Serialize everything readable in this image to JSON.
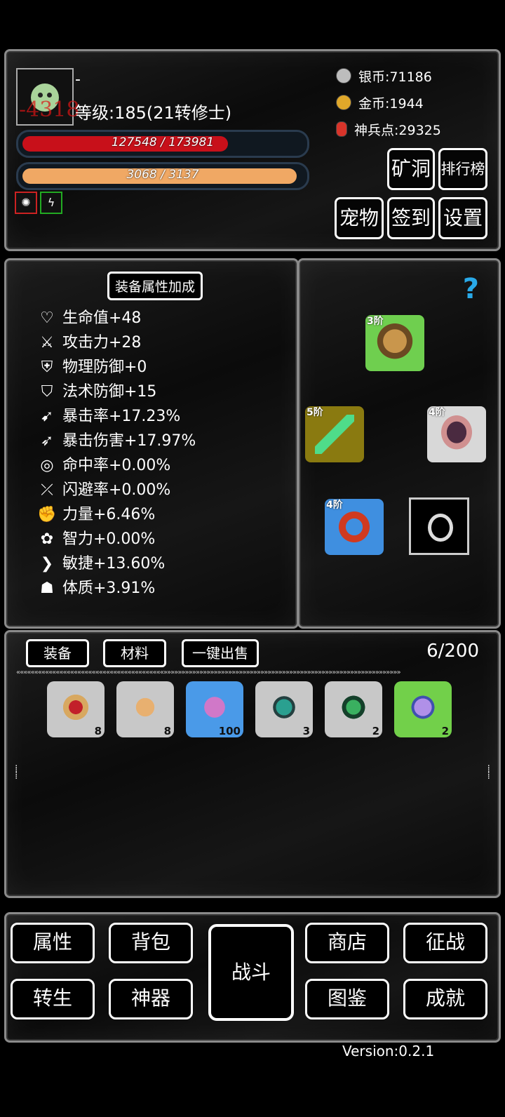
{
  "player": {
    "name": "-",
    "damage_popup": "-4318",
    "level_text": "等级:185(21转修士)",
    "hp_text": "127548 / 173981",
    "hp_ratio": 0.7331,
    "mp_text": "3068 / 3137",
    "mp_ratio": 0.978
  },
  "currency": {
    "silver": "银币:71186",
    "gold": "金币:1944",
    "artifact_points": "神兵点:29325"
  },
  "top_buttons": {
    "mine": "矿洞",
    "ranking": "排行榜",
    "pet": "宠物",
    "checkin": "签到",
    "settings": "设置"
  },
  "attributes": {
    "title": "装备属性加成",
    "rows": [
      {
        "icon": "heart-icon",
        "label": "生命值+48"
      },
      {
        "icon": "sword-icon",
        "label": "攻击力+28"
      },
      {
        "icon": "shield-icon",
        "label": "物理防御+0"
      },
      {
        "icon": "magic-shield-icon",
        "label": "法术防御+15"
      },
      {
        "icon": "crit-arrows-icon",
        "label": "暴击率+17.23%"
      },
      {
        "icon": "crit-damage-icon",
        "label": "暴击伤害+17.97%"
      },
      {
        "icon": "target-icon",
        "label": "命中率+0.00%"
      },
      {
        "icon": "dodge-icon",
        "label": "闪避率+0.00%"
      },
      {
        "icon": "muscle-icon",
        "label": "力量+6.46%"
      },
      {
        "icon": "brain-icon",
        "label": "智力+0.00%"
      },
      {
        "icon": "wing-icon",
        "label": "敏捷+13.60%"
      },
      {
        "icon": "body-icon",
        "label": "体质+3.91%"
      }
    ]
  },
  "equipment": {
    "help": "?",
    "helmet": {
      "tier": "3阶"
    },
    "weapon": {
      "tier": "5阶"
    },
    "shield": {
      "tier": "4阶"
    },
    "necklace": {
      "tier": "4阶"
    }
  },
  "bag": {
    "tab_equipment": "装备",
    "tab_materials": "材料",
    "sell_all": "一键出售",
    "count": "6/200",
    "items": [
      {
        "name": "red-gem-item",
        "qty": "8"
      },
      {
        "name": "amber-stone-item",
        "qty": "8"
      },
      {
        "name": "pink-crystal-item",
        "qty": "100"
      },
      {
        "name": "teal-ore-item",
        "qty": "3"
      },
      {
        "name": "spiked-green-orb-item",
        "qty": "2"
      },
      {
        "name": "purple-orb-item",
        "qty": "2"
      }
    ]
  },
  "nav": {
    "attributes": "属性",
    "backpack": "背包",
    "battle": "战斗",
    "shop": "商店",
    "conquest": "征战",
    "rebirth": "转生",
    "artifact": "神器",
    "codex": "图鉴",
    "achievements": "成就"
  },
  "version": "Version:0.2.1"
}
